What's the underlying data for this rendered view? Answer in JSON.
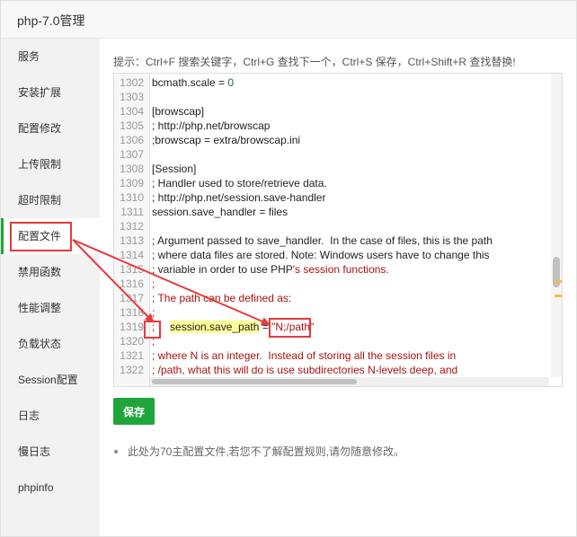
{
  "window": {
    "title": "php-7.0管理"
  },
  "sidebar": {
    "items": [
      {
        "label": "服务"
      },
      {
        "label": "安装扩展"
      },
      {
        "label": "配置修改"
      },
      {
        "label": "上传限制"
      },
      {
        "label": "超时限制"
      },
      {
        "label": "配置文件"
      },
      {
        "label": "禁用函数"
      },
      {
        "label": "性能调整"
      },
      {
        "label": "负载状态"
      },
      {
        "label": "Session配置"
      },
      {
        "label": "日志"
      },
      {
        "label": "慢日志"
      },
      {
        "label": "phpinfo"
      }
    ],
    "active_index": 5
  },
  "main": {
    "tip": "提示：Ctrl+F 搜索关键字，Ctrl+G 查找下一个，Ctrl+S 保存，Ctrl+Shift+R 查找替换!",
    "save_label": "保存",
    "note": "此处为70主配置文件,若您不了解配置规则,请勿随意修改。"
  },
  "editor": {
    "lines": [
      {
        "n": "1302",
        "parts": [
          {
            "t": "bcmath.scale = ",
            "c": ""
          },
          {
            "t": "0",
            "c": "num"
          }
        ]
      },
      {
        "n": "1303",
        "parts": []
      },
      {
        "n": "1304",
        "parts": [
          {
            "t": "[browscap]",
            "c": ""
          }
        ]
      },
      {
        "n": "1305",
        "parts": [
          {
            "t": "; http://php.net/browscap",
            "c": ""
          }
        ]
      },
      {
        "n": "1306",
        "parts": [
          {
            "t": ";browscap = extra/browscap.ini",
            "c": ""
          }
        ]
      },
      {
        "n": "1307",
        "parts": []
      },
      {
        "n": "1308",
        "parts": [
          {
            "t": "[Session]",
            "c": ""
          }
        ]
      },
      {
        "n": "1309",
        "parts": [
          {
            "t": "; Handler used to store/retrieve data.",
            "c": ""
          }
        ]
      },
      {
        "n": "1310",
        "parts": [
          {
            "t": "; http://php.net/session.save-handler",
            "c": ""
          }
        ]
      },
      {
        "n": "1311",
        "parts": [
          {
            "t": "session.save_handler = files",
            "c": ""
          }
        ]
      },
      {
        "n": "1312",
        "parts": []
      },
      {
        "n": "1313",
        "parts": [
          {
            "t": "; Argument passed to save_handler.  In the case of files, this is the path",
            "c": ""
          }
        ]
      },
      {
        "n": "1314",
        "parts": [
          {
            "t": "; where data files are stored. Note: Windows users have to change this",
            "c": ""
          }
        ]
      },
      {
        "n": "1315",
        "parts": [
          {
            "t": "; variable in order to use PHP",
            "c": ""
          },
          {
            "t": "'s session functions.",
            "c": "comment"
          }
        ]
      },
      {
        "n": "1316",
        "parts": [
          {
            "t": ";",
            "c": "comment"
          }
        ]
      },
      {
        "n": "1317",
        "parts": [
          {
            "t": "; The path can be defined as:",
            "c": "comment"
          }
        ]
      },
      {
        "n": "1318",
        "parts": [
          {
            "t": ";",
            "c": "comment"
          }
        ]
      },
      {
        "n": "1319",
        "parts": [
          {
            "t": ";",
            "c": "comment"
          },
          {
            "t": "     ",
            "c": ""
          },
          {
            "t": "session.save_path",
            "c": "hl"
          },
          {
            "t": " = ",
            "c": ""
          },
          {
            "t": "\"N;/path\"",
            "c": "str"
          }
        ]
      },
      {
        "n": "1320",
        "parts": [
          {
            "t": ";",
            "c": "comment"
          }
        ]
      },
      {
        "n": "1321",
        "parts": [
          {
            "t": "; where N is an integer.  Instead of storing all the session files in",
            "c": "comment"
          }
        ]
      },
      {
        "n": "1322",
        "parts": [
          {
            "t": "; /path, what this will do is use subdirectories N-levels deep, and",
            "c": "comment"
          }
        ]
      }
    ]
  },
  "colors": {
    "accent": "#20a53a",
    "annotation": "#e8393c",
    "comment": "#aa1111",
    "number": "#116644",
    "highlight": "#ffff99"
  }
}
